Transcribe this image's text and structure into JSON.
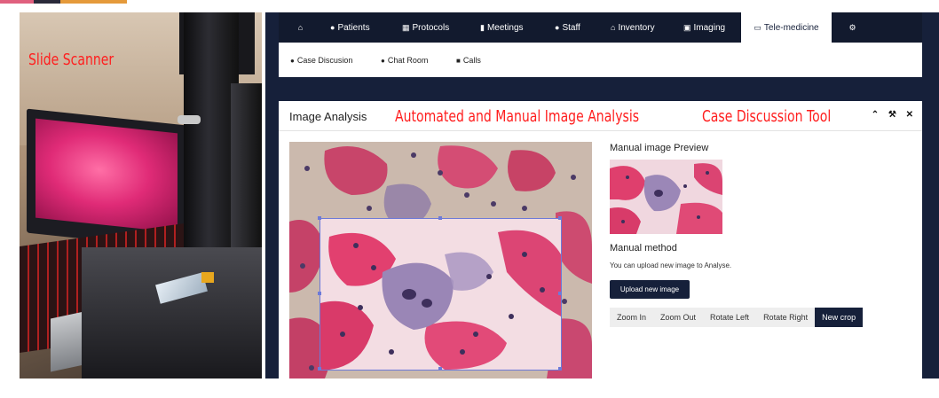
{
  "overlay_labels": {
    "slide_scanner": "Slide Scanner",
    "analysis": "Automated and Manual Image Analysis",
    "discussion": "Case Discussion Tool"
  },
  "nav": {
    "items": [
      {
        "label": "",
        "icon": "home-icon"
      },
      {
        "label": "Patients",
        "icon": "users-icon"
      },
      {
        "label": "Protocols",
        "icon": "chart-icon"
      },
      {
        "label": "Meetings",
        "icon": "book-icon"
      },
      {
        "label": "Staff",
        "icon": "user-icon"
      },
      {
        "label": "Inventory",
        "icon": "bank-icon"
      },
      {
        "label": "Imaging",
        "icon": "image-icon"
      },
      {
        "label": "Tele-medicine",
        "icon": "monitor-icon",
        "active": true
      },
      {
        "label": "",
        "icon": "gear-icon"
      }
    ]
  },
  "subnav": {
    "items": [
      {
        "label": "Case Discusion",
        "icon": "comments-icon"
      },
      {
        "label": "Chat Room",
        "icon": "comments-icon"
      },
      {
        "label": "Calls",
        "icon": "video-icon"
      }
    ]
  },
  "panel": {
    "title": "Image Analysis",
    "tools": [
      "chevron-up-icon",
      "wrench-icon",
      "close-icon"
    ],
    "preview_title": "Manual image Preview",
    "method_title": "Manual method",
    "method_desc": "You can upload new image to Analyse.",
    "upload_label": "Upload new image",
    "buttons": [
      "Zoom In",
      "Zoom Out",
      "Rotate Left",
      "Rotate Right",
      "New crop"
    ]
  },
  "colors": {
    "navy": "#16203a",
    "overlay_red": "#ff1e1e",
    "crop_border": "#6d7ad8"
  }
}
